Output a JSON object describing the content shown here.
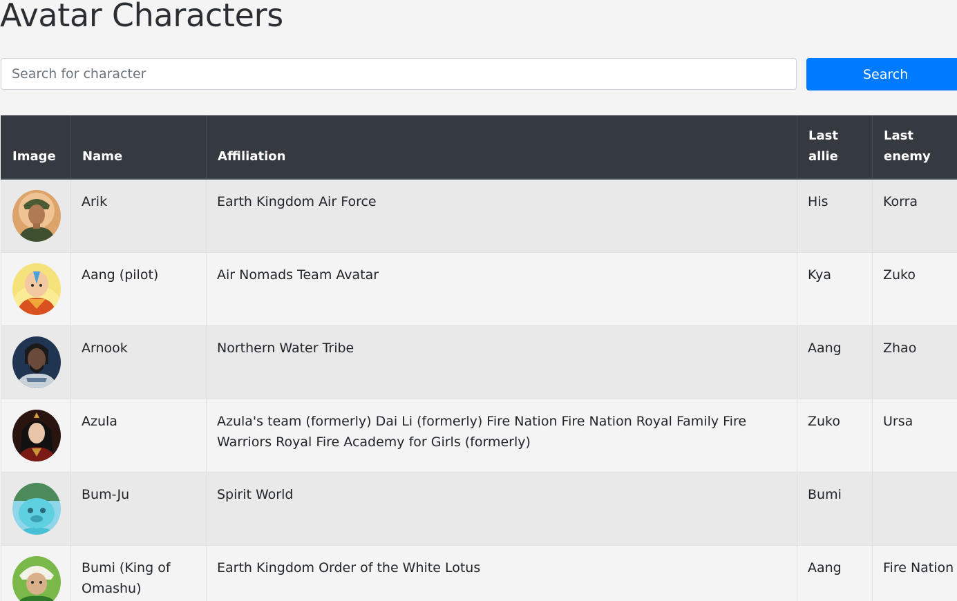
{
  "page": {
    "title": "Avatar Characters"
  },
  "search": {
    "placeholder": "Search for character",
    "value": "",
    "button_label": "Search"
  },
  "colors": {
    "header_bg": "#343a40",
    "button_bg": "#007bff",
    "row_odd": "#e9e9e9",
    "row_even": "#f4f4f4"
  },
  "table": {
    "headers": {
      "image": "Image",
      "name": "Name",
      "affiliation": "Affiliation",
      "last_allie": "Last allie",
      "last_enemy": "Last enemy"
    },
    "rows": [
      {
        "name": "Arik",
        "affiliation": "Earth Kingdom Air Force",
        "last_allie": "His",
        "last_enemy": "Korra",
        "avatar": "arik-portrait"
      },
      {
        "name": "Aang (pilot)",
        "affiliation": "Air Nomads Team Avatar",
        "last_allie": "Kya",
        "last_enemy": "Zuko",
        "avatar": "aang-portrait"
      },
      {
        "name": "Arnook",
        "affiliation": "Northern Water Tribe",
        "last_allie": "Aang",
        "last_enemy": "Zhao",
        "avatar": "arnook-portrait"
      },
      {
        "name": "Azula",
        "affiliation": "Azula's team (formerly) Dai Li (formerly) Fire Nation Fire Nation Royal Family Fire Warriors Royal Fire Academy for Girls (formerly)",
        "last_allie": "Zuko",
        "last_enemy": "Ursa",
        "avatar": "azula-portrait"
      },
      {
        "name": "Bum-Ju",
        "affiliation": "Spirit World",
        "last_allie": "Bumi",
        "last_enemy": "",
        "avatar": "bum-ju-portrait"
      },
      {
        "name": "Bumi (King of Omashu)",
        "affiliation": "Earth Kingdom Order of the White Lotus",
        "last_allie": "Aang",
        "last_enemy": "Fire Nation",
        "avatar": "bumi-portrait"
      }
    ]
  }
}
